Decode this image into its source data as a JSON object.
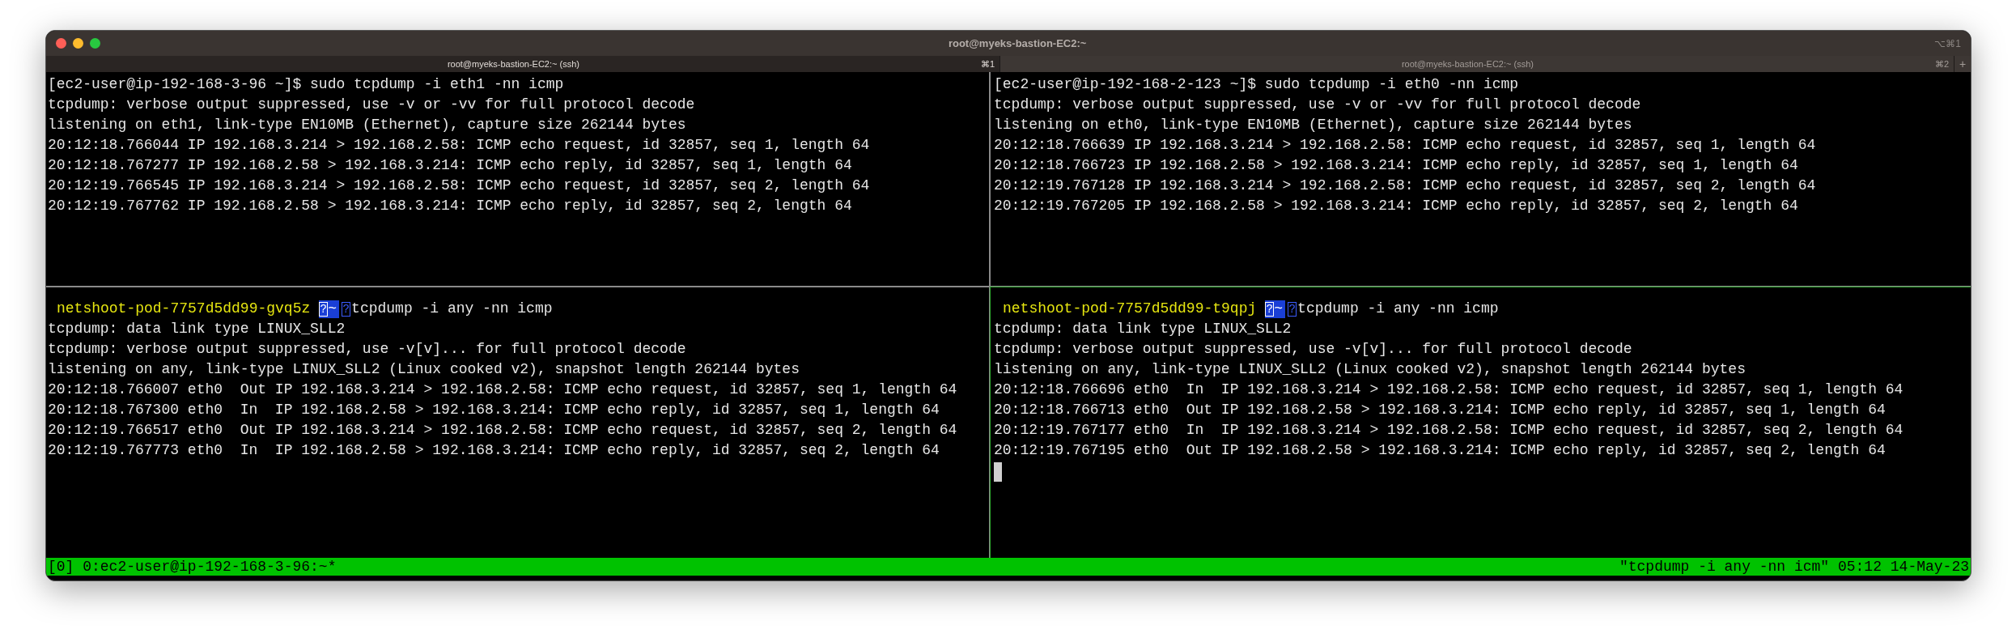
{
  "window": {
    "title": "root@myeks-bastion-EC2:~",
    "shortcut": "⌥⌘1"
  },
  "tabs": [
    {
      "label": "root@myeks-bastion-EC2:~ (ssh)",
      "shortcut": "⌘1",
      "selected": true
    },
    {
      "label": "root@myeks-bastion-EC2:~ (ssh)",
      "shortcut": "⌘2",
      "selected": false
    }
  ],
  "new_tab": "+",
  "panes": [
    {
      "kind": "shell",
      "active": false,
      "prompt": "[ec2-user@ip-192-168-3-96 ~]$ sudo tcpdump -i eth1 -nn icmp",
      "lines": [
        "tcpdump: verbose output suppressed, use -v or -vv for full protocol decode",
        "listening on eth1, link-type EN10MB (Ethernet), capture size 262144 bytes",
        "20:12:18.766044 IP 192.168.3.214 > 192.168.2.58: ICMP echo request, id 32857, seq 1, length 64",
        "20:12:18.767277 IP 192.168.2.58 > 192.168.3.214: ICMP echo reply, id 32857, seq 1, length 64",
        "20:12:19.766545 IP 192.168.3.214 > 192.168.2.58: ICMP echo request, id 32857, seq 2, length 64",
        "20:12:19.767762 IP 192.168.2.58 > 192.168.3.214: ICMP echo reply, id 32857, seq 2, length 64"
      ]
    },
    {
      "kind": "shell",
      "active": false,
      "prompt": "[ec2-user@ip-192-168-2-123 ~]$ sudo tcpdump -i eth0 -nn icmp",
      "lines": [
        "tcpdump: verbose output suppressed, use -v or -vv for full protocol decode",
        "listening on eth0, link-type EN10MB (Ethernet), capture size 262144 bytes",
        "20:12:18.766639 IP 192.168.3.214 > 192.168.2.58: ICMP echo request, id 32857, seq 1, length 64",
        "20:12:18.766723 IP 192.168.2.58 > 192.168.3.214: ICMP echo reply, id 32857, seq 1, length 64",
        "20:12:19.767128 IP 192.168.3.214 > 192.168.2.58: ICMP echo request, id 32857, seq 2, length 64",
        "20:12:19.767205 IP 192.168.2.58 > 192.168.3.214: ICMP echo reply, id 32857, seq 2, length 64"
      ]
    },
    {
      "kind": "pod",
      "active": false,
      "host": "netshoot-pod-7757d5dd99-gvq5z",
      "glyph": "?",
      "dir": "~",
      "command": "tcpdump -i any -nn icmp",
      "lines": [
        "tcpdump: data link type LINUX_SLL2",
        "tcpdump: verbose output suppressed, use -v[v]... for full protocol decode",
        "listening on any, link-type LINUX_SLL2 (Linux cooked v2), snapshot length 262144 bytes",
        "20:12:18.766007 eth0  Out IP 192.168.3.214 > 192.168.2.58: ICMP echo request, id 32857, seq 1, length 64",
        "20:12:18.767300 eth0  In  IP 192.168.2.58 > 192.168.3.214: ICMP echo reply, id 32857, seq 1, length 64",
        "20:12:19.766517 eth0  Out IP 192.168.3.214 > 192.168.2.58: ICMP echo request, id 32857, seq 2, length 64",
        "20:12:19.767773 eth0  In  IP 192.168.2.58 > 192.168.3.214: ICMP echo reply, id 32857, seq 2, length 64"
      ]
    },
    {
      "kind": "pod",
      "active": true,
      "cursor": true,
      "host": "netshoot-pod-7757d5dd99-t9qpj",
      "glyph": "?",
      "dir": "~",
      "command": "tcpdump -i any -nn icmp",
      "lines": [
        "tcpdump: data link type LINUX_SLL2",
        "tcpdump: verbose output suppressed, use -v[v]... for full protocol decode",
        "listening on any, link-type LINUX_SLL2 (Linux cooked v2), snapshot length 262144 bytes",
        "20:12:18.766696 eth0  In  IP 192.168.3.214 > 192.168.2.58: ICMP echo request, id 32857, seq 1, length 64",
        "20:12:18.766713 eth0  Out IP 192.168.2.58 > 192.168.3.214: ICMP echo reply, id 32857, seq 1, length 64",
        "20:12:19.767177 eth0  In  IP 192.168.3.214 > 192.168.2.58: ICMP echo request, id 32857, seq 2, length 64",
        "20:12:19.767195 eth0  Out IP 192.168.2.58 > 192.168.3.214: ICMP echo reply, id 32857, seq 2, length 64"
      ]
    }
  ],
  "status_bar": {
    "left": "[0] 0:ec2-user@ip-192-168-3-96:~*",
    "right": "\"tcpdump -i any -nn icm\" 05:12 14-May-23"
  }
}
